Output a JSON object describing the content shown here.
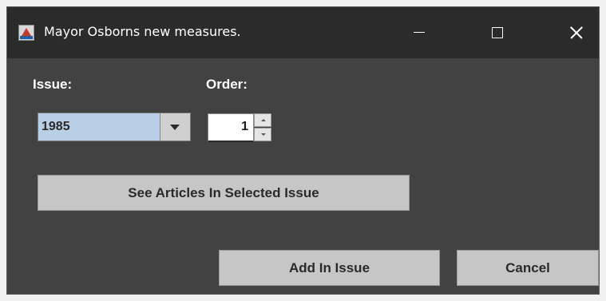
{
  "window": {
    "title": "Mayor Osborns new measures.",
    "app_icon": "java-app-icon",
    "controls": {
      "minimize_icon": "minimize-icon",
      "maximize_icon": "maximize-icon",
      "close_icon": "close-icon"
    }
  },
  "form": {
    "issue_label": "Issue:",
    "issue_selected": "1985",
    "order_label": "Order:",
    "order_value": "1"
  },
  "buttons": {
    "see_articles": "See Articles In Selected Issue",
    "add_in_issue": "Add In Issue",
    "cancel": "Cancel"
  },
  "colors": {
    "window_bg": "#424242",
    "titlebar_bg": "#2b2b2b",
    "combo_selected_bg": "#b8cfe5",
    "button_bg": "#c6c6c6"
  }
}
